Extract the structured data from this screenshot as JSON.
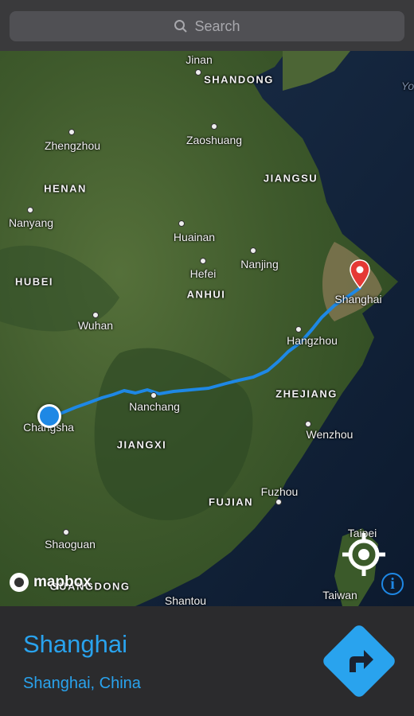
{
  "search": {
    "placeholder": "Search",
    "icon": "magnifier-icon"
  },
  "map": {
    "provinces": [
      "SHANDONG",
      "HENAN",
      "JIANGSU",
      "HUBEI",
      "ANHUI",
      "ZHEJIANG",
      "JIANGXI",
      "FUJIAN",
      "GUANGDONG"
    ],
    "cities": {
      "jinan": "Jinan",
      "zhengzhou": "Zhengzhou",
      "zaoshuang": "Zaoshuang",
      "nanyang": "Nanyang",
      "huainan": "Huainan",
      "nanjing": "Nanjing",
      "hefei": "Hefei",
      "shanghai": "Shanghai",
      "wuhan": "Wuhan",
      "hangzhou": "Hangzhou",
      "nanchang": "Nanchang",
      "changsha": "Changsha",
      "wenzhou": "Wenzhou",
      "fuzhou": "Fuzhou",
      "shaoguan": "Shaoguan",
      "taipei": "Taipei",
      "taiwan": "Taiwan",
      "shantou": "Shantou",
      "yo": "Yo"
    },
    "route_color": "#1e88e5",
    "pin_color": "#e53935",
    "attribution": "mapbox"
  },
  "destination": {
    "name": "Shanghai",
    "subtitle": "Shanghai, China"
  },
  "colors": {
    "accent": "#29a3ee",
    "panel": "#2b2b2d"
  }
}
